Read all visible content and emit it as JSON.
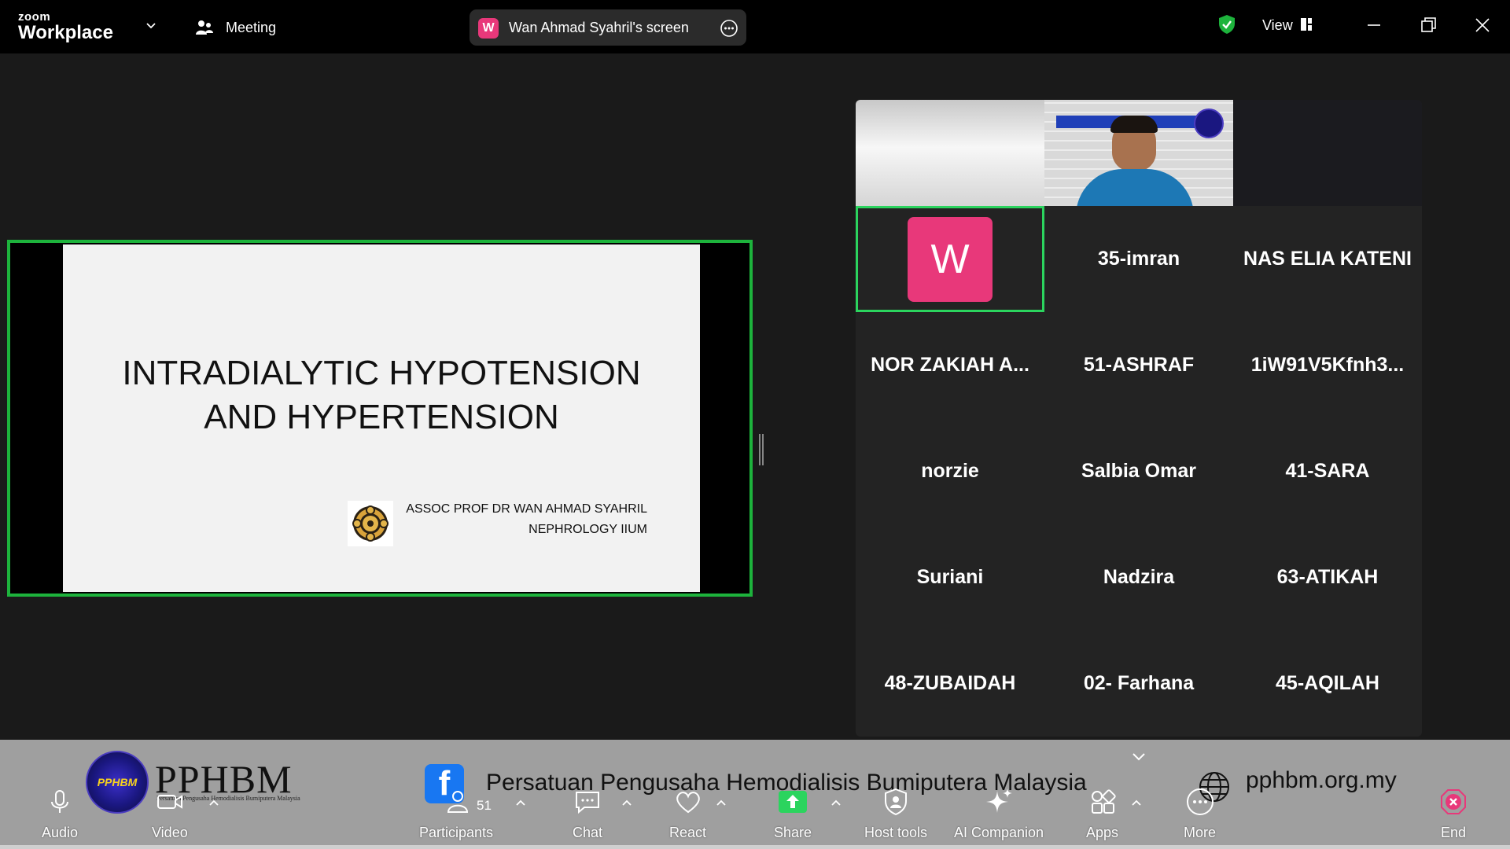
{
  "app": {
    "brand_small": "zoom",
    "brand_big": "Workplace"
  },
  "topbar": {
    "meeting_label": "Meeting",
    "share_badge": "W",
    "share_label": "Wan Ahmad Syahril's screen",
    "view_label": "View"
  },
  "slide": {
    "title_line1": "INTRADIALYTIC HYPOTENSION",
    "title_line2": "AND HYPERTENSION",
    "author_line1": "ASSOC PROF DR WAN AHMAD SYAHRIL",
    "author_line2": "NEPHROLOGY IIUM"
  },
  "gallery": {
    "active_initial": "W",
    "participants": [
      "35-imran",
      "NAS ELIA KATENI",
      "NOR  ZAKIAH  A...",
      "51-ASHRAF",
      "1iW91V5Kfnh3...",
      "norzie",
      "Salbia Omar",
      "41-SARA",
      "Suriani",
      "Nadzira",
      "63-ATIKAH",
      "48-ZUBAIDAH",
      "02- Farhana",
      "45-AQILAH"
    ]
  },
  "banner": {
    "logo_short": "PPHBM",
    "logo_text": "PPHBM",
    "logo_sub": "Persatuan Pengusaha Hemodialisis Bumiputera Malaysia",
    "fb_glyph": "f",
    "org_name": "Persatuan Pengusaha Hemodialisis Bumiputera Malaysia",
    "website": "pphbm.org.my"
  },
  "toolbar": {
    "audio": "Audio",
    "video": "Video",
    "participants": "Participants",
    "participants_count": "51",
    "chat": "Chat",
    "react": "React",
    "share": "Share",
    "host_tools": "Host tools",
    "ai_companion": "AI Companion",
    "apps": "Apps",
    "more": "More",
    "end": "End"
  },
  "colors": {
    "accent_green": "#1db33c",
    "badge_pink": "#e8387a",
    "share_green": "#2bd45e"
  }
}
